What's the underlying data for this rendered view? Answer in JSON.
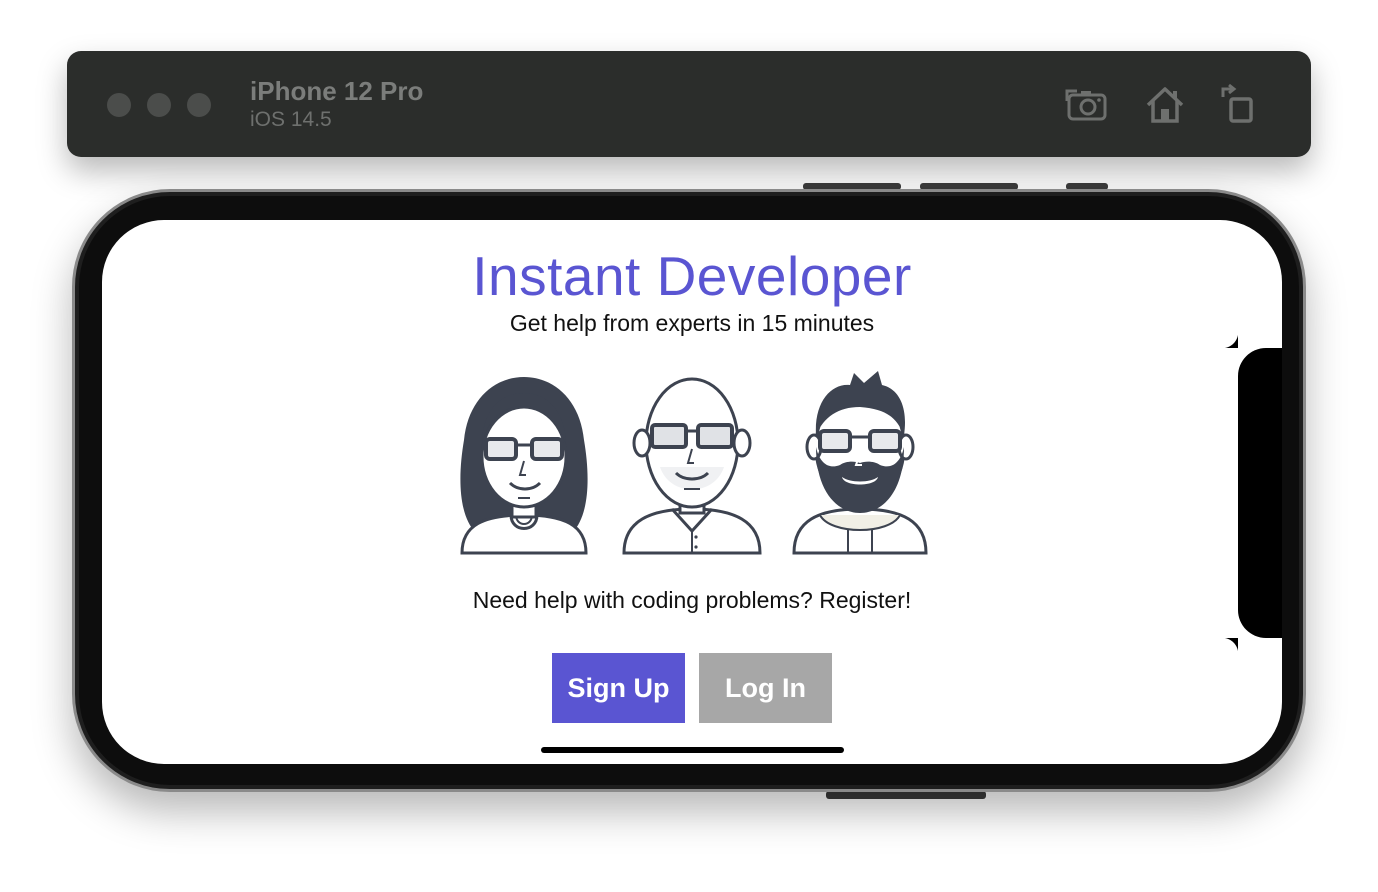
{
  "simulator": {
    "device_name": "iPhone 12 Pro",
    "os_version": "iOS 14.5",
    "toolbar_icons": [
      "screenshot-icon",
      "home-icon",
      "rotate-icon"
    ]
  },
  "app": {
    "title": "Instant Developer",
    "subtitle": "Get help from experts in 15 minutes",
    "prompt": "Need help with coding problems? Register!",
    "signup_label": "Sign Up",
    "login_label": "Log In"
  },
  "colors": {
    "accent": "#5a55d2",
    "secondary_button": "#a7a7a7",
    "sim_bar": "#2b2d2b"
  }
}
